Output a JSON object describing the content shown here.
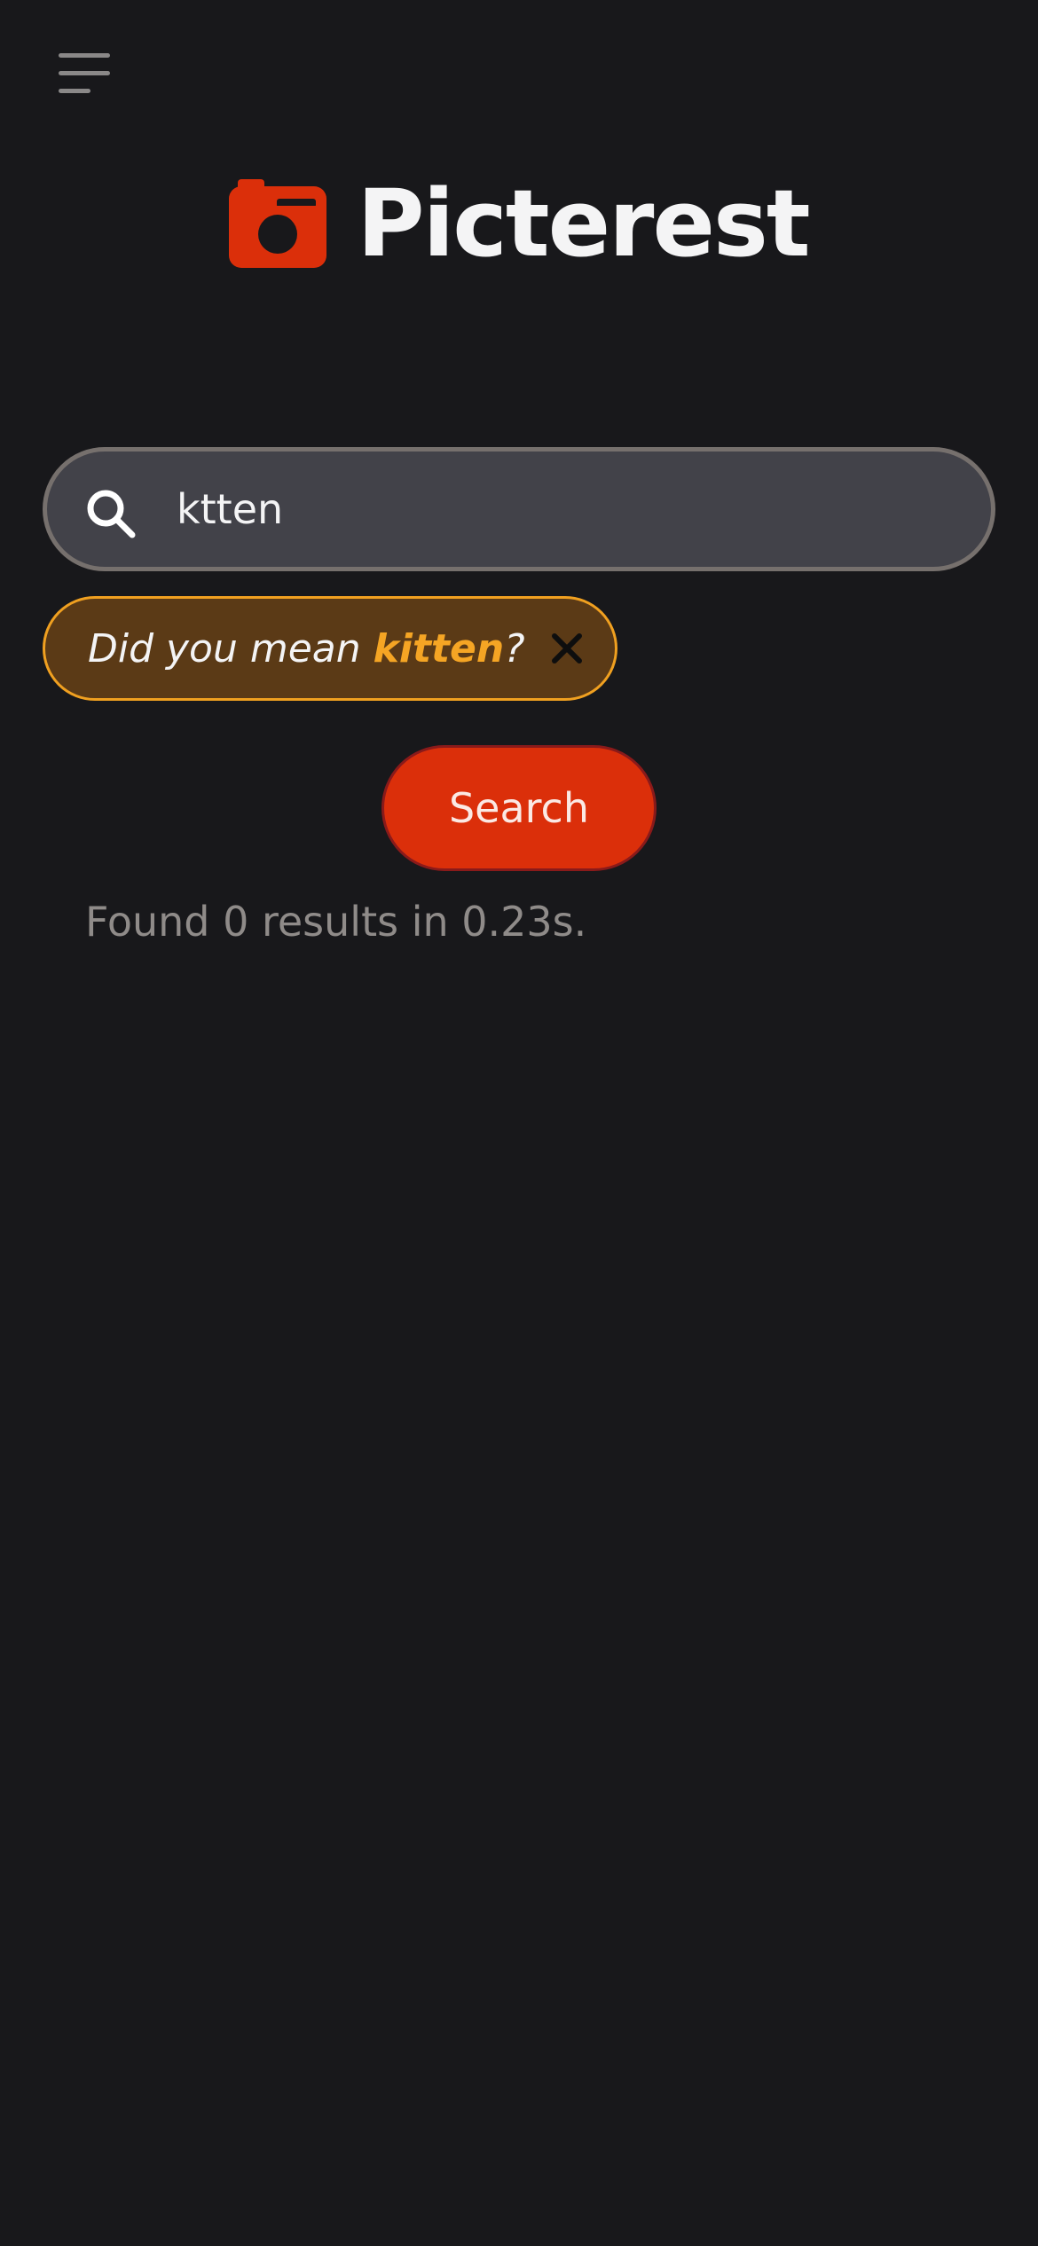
{
  "header": {
    "menu_icon": "hamburger-menu-icon",
    "brand": {
      "logo_icon": "camera-icon",
      "name": "Picterest",
      "accent_color": "#db2f0a"
    }
  },
  "search": {
    "icon": "search-icon",
    "value": "ktten",
    "placeholder": ""
  },
  "suggestion": {
    "prefix": "Did you mean ",
    "word": "kitten",
    "suffix": "?",
    "dismiss_icon": "close-icon",
    "highlight_color": "#f5a524"
  },
  "search_button": {
    "label": "Search"
  },
  "results": {
    "status": "Found 0 results in 0.23s."
  }
}
